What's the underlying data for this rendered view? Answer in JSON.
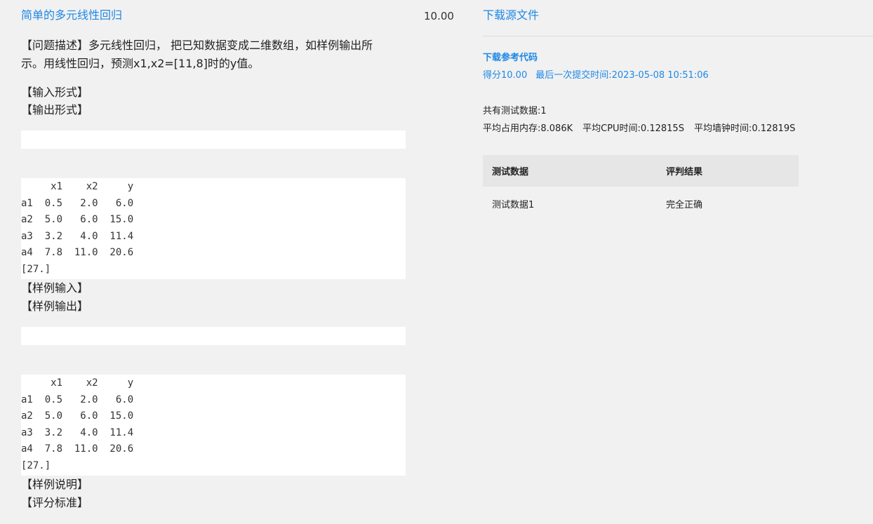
{
  "problem": {
    "title": "简单的多元线性回归",
    "score": "10.00",
    "description_line1": "【问题描述】多元线性回归， 把已知数据变成二维数组，如样例输出所",
    "description_line2": "示。用线性回归，预测x1,x2=[11,8]时的y值。",
    "input_format": "【输入形式】",
    "output_format": "【输出形式】",
    "sample_input": "【样例输入】",
    "sample_output": "【样例输出】",
    "sample_explain": "【样例说明】",
    "grading": "【评分标准】"
  },
  "output_code": {
    "lines": [
      "     x1    x2     y",
      "a1  0.5   2.0   6.0",
      "a2  5.0   6.0  15.0",
      "a3  3.2   4.0  11.4",
      "a4  7.8  11.0  20.6",
      "[27.]"
    ]
  },
  "sample_output_code": {
    "lines": [
      "     x1    x2     y",
      "a1  0.5   2.0   6.0",
      "a2  5.0   6.0  15.0",
      "a3  3.2   4.0  11.4",
      "a4  7.8  11.0  20.6",
      "[27.]"
    ]
  },
  "sidebar": {
    "download_source": "下载源文件",
    "download_reference": "下载参考代码",
    "score_text": "得分10.00",
    "last_submit": "最后一次提交时间:2023-05-08 10:51:06",
    "test_count": "共有测试数据:1",
    "avg_memory": "平均占用内存:8.086K",
    "avg_cpu": "平均CPU时间:0.12815S",
    "avg_wall": "平均墙钟时间:0.12819S",
    "table": {
      "headers": [
        "测试数据",
        "评判结果"
      ],
      "rows": [
        [
          "测试数据1",
          "完全正确"
        ]
      ]
    }
  },
  "colors": {
    "link": "#1e88e5",
    "background": "#f1f1f1",
    "table_header": "#e6e6e6"
  }
}
